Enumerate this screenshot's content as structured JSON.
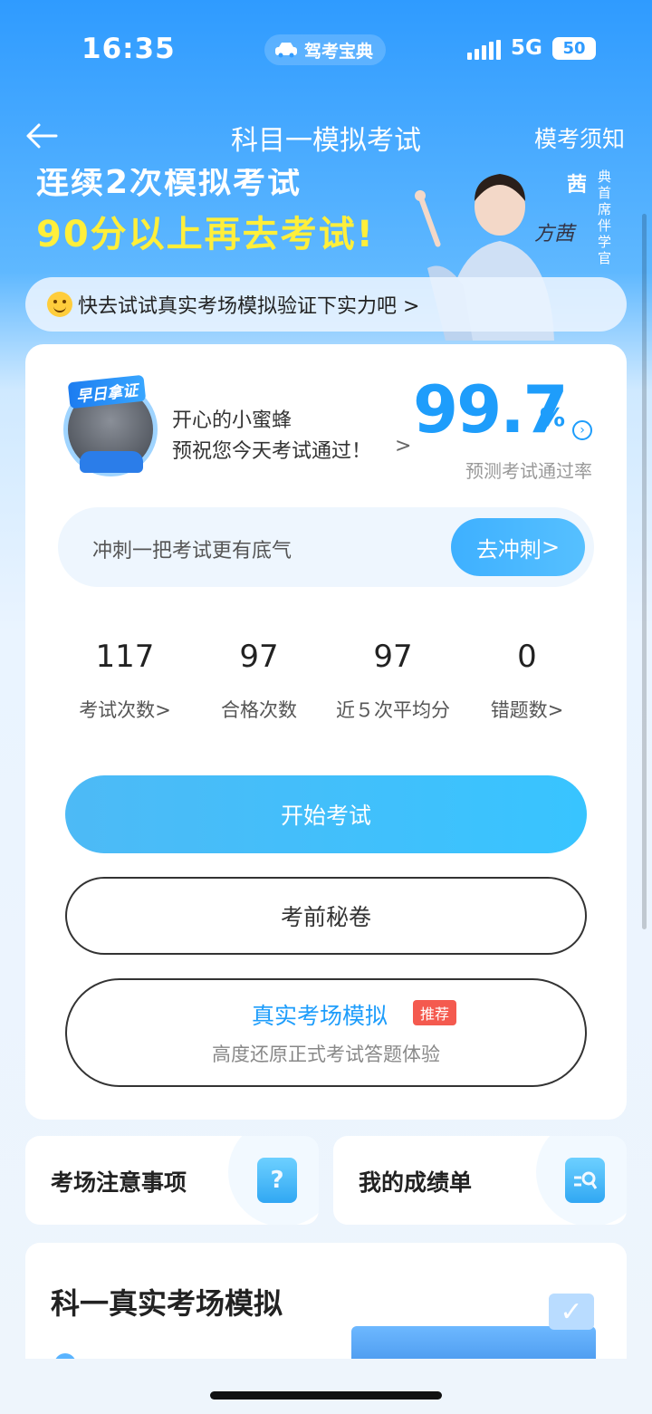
{
  "status_bar": {
    "time": "16:35",
    "app_name": "驾考宝典",
    "network": "5G",
    "battery": "50"
  },
  "nav": {
    "title": "科目一模拟考试",
    "right_link": "模考须知"
  },
  "banner": {
    "line1": "连续2次模拟考试",
    "line2": "90分以上再去考试!",
    "person_name": "茜",
    "person_title": "典首席伴学官",
    "signature": "方茜",
    "notice": "快去试试真实考场模拟验证下实力吧 >"
  },
  "profile": {
    "badge": "早日拿证",
    "nickname": "开心的小蜜蜂",
    "wish": "预祝您今天考试通过！",
    "rate_value": "99.7",
    "rate_unit": "%",
    "rate_label": "预测考试通过率"
  },
  "sprint": {
    "text": "冲刺一把考试更有底气",
    "button": "去冲刺"
  },
  "stats": [
    {
      "value": "117",
      "label": "考试次数"
    },
    {
      "value": "97",
      "label": "合格次数"
    },
    {
      "value": "97",
      "label": "近５次平均分"
    },
    {
      "value": "0",
      "label": "错题数"
    }
  ],
  "buttons": {
    "start": "开始考试",
    "secret": "考前秘卷",
    "real_title": "真实考场模拟",
    "real_tag": "推荐",
    "real_subtitle": "高度还原正式考试答题体验"
  },
  "tiles": {
    "notice_label": "考场注意事项",
    "notice_icon": "question-icon",
    "report_label": "我的成绩单",
    "report_icon": "search-doc-icon"
  },
  "section": {
    "title": "科一真实考场模拟"
  },
  "colors": {
    "primary_blue": "#1e9dfb",
    "banner_yellow": "#ffef3a",
    "tag_red": "#f45a4f"
  }
}
